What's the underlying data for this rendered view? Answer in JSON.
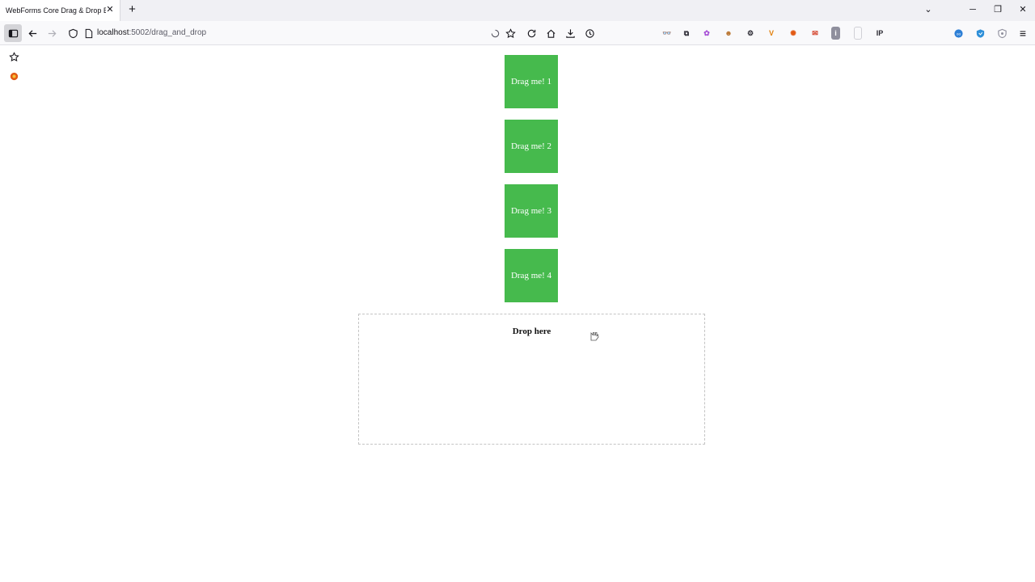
{
  "tab": {
    "title": "WebForms Core Drag & Drop Exam",
    "close_symbol": "✕"
  },
  "window": {
    "new_tab_symbol": "+",
    "list_tabs_symbol": "⌄",
    "minimize_symbol": "─",
    "restore_symbol": "❐",
    "close_symbol": "✕"
  },
  "address": {
    "host": "localhost",
    "path": ":5002/drag_and_drop"
  },
  "extensions": [
    {
      "name": "glasses-extension-icon",
      "glyph": "👓",
      "color": "#2b2a33"
    },
    {
      "name": "puzzle-extension-icon",
      "glyph": "⧉",
      "color": "#2b2a33"
    },
    {
      "name": "flower-extension-icon",
      "glyph": "✿",
      "color": "#a64fd6"
    },
    {
      "name": "monkey-extension-icon",
      "glyph": "☻",
      "color": "#b8722c"
    },
    {
      "name": "gift-extension-icon",
      "glyph": "⚙",
      "color": "#2b2a33"
    },
    {
      "name": "v-extension-icon",
      "glyph": "V",
      "color": "#e2800c"
    },
    {
      "name": "fox-extension-icon",
      "glyph": "✺",
      "color": "#e25a14"
    },
    {
      "name": "megaphone-extension-icon",
      "glyph": "✉",
      "color": "#d23a22"
    },
    {
      "name": "info-extension-icon",
      "glyph": "i",
      "color": "#6e6e78"
    },
    {
      "name": "blank-extension-icon",
      "glyph": "",
      "color": "#d0d0d6"
    },
    {
      "name": "ip-extension-icon",
      "glyph": "IP",
      "color": "#2b2a33"
    }
  ],
  "right_icons": [
    {
      "name": "circle-extension-icon",
      "color": "#2d7fd6"
    },
    {
      "name": "shield-blue-extension-icon",
      "color": "#2e8fd8"
    },
    {
      "name": "shield-gray-extension-icon",
      "color": "#8f8f9d"
    }
  ],
  "menu_symbol": "≡",
  "page": {
    "drag_items": [
      "Drag me! 1",
      "Drag me! 2",
      "Drag me! 3",
      "Drag me! 4"
    ],
    "drop_label": "Drop here"
  },
  "colors": {
    "drag_box": "#46ba4d",
    "drop_border": "#c4c4c4"
  }
}
